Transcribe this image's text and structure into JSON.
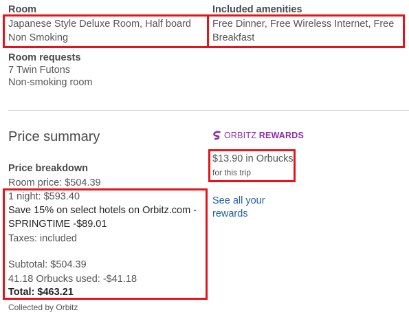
{
  "room": {
    "heading": "Room",
    "line1": "Japanese Style Deluxe Room, Half board",
    "line2": "Non Smoking"
  },
  "amenities": {
    "heading": "Included amenities",
    "line1": "Free Dinner, Free Wireless Internet, Free",
    "line2": "Breakfast"
  },
  "room_requests": {
    "heading": "Room requests",
    "items": [
      "7 Twin Futons",
      "Non-smoking room"
    ]
  },
  "price_summary": {
    "title": "Price summary",
    "breakdown_heading": "Price breakdown",
    "room_price": "Room price: $504.39",
    "night": "1 night: $593.40",
    "promo_line1": "Save 15% on select hotels on Orbitz.com -",
    "promo_line2": "SPRINGTIME -$89.01",
    "taxes": "Taxes: included",
    "subtotal": "Subtotal: $504.39",
    "orbucks_used": "41.18 Orbucks used: -$41.18",
    "total": "Total: $463.21",
    "collected_by": "Collected by Orbitz"
  },
  "rewards": {
    "brand_light": "ORBITZ",
    "brand_bold": "REWARDS",
    "orbucks_amount": "$13.90 in Orbucks",
    "orbucks_note": "for this trip",
    "link_line1": "See all your",
    "link_line2": "rewards",
    "icon": "orbitz-logo-icon",
    "brand_color": "#8e2ba6"
  },
  "colors": {
    "highlight": "#e3151a",
    "link": "#1f5fa8",
    "text": "#4a4a4a"
  }
}
